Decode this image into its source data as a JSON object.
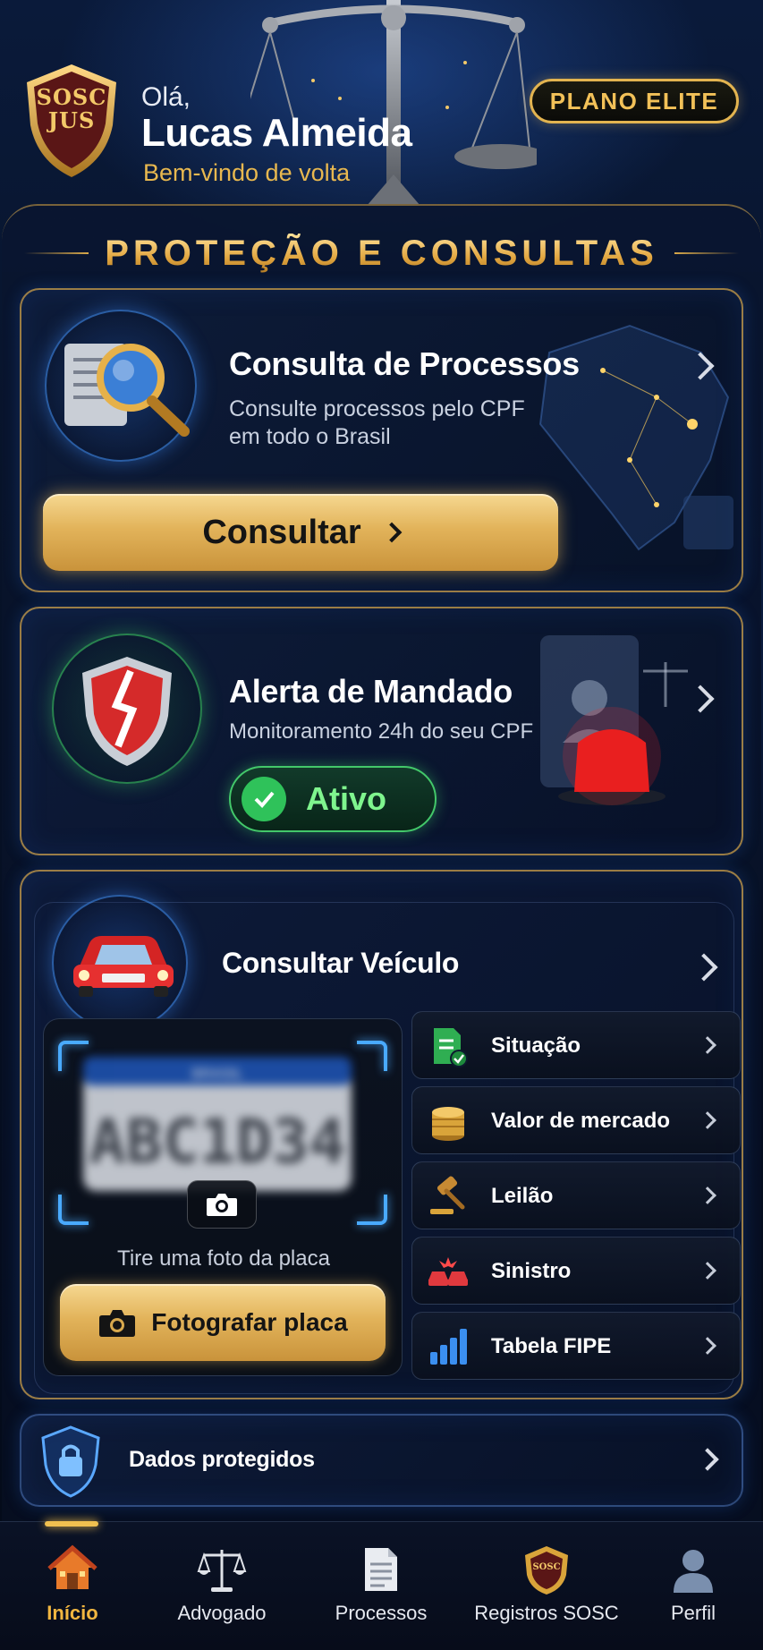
{
  "header": {
    "logo": "SOSC JUS",
    "greeting": "Olá,",
    "user_name": "Lucas Almeida",
    "welcome": "Bem-vindo de volta",
    "plan": "PLANO ELITE"
  },
  "section": {
    "title": "PROTEÇÃO E CONSULTAS"
  },
  "processos": {
    "title": "Consulta de Processos",
    "subtitle_line1": "Consulte processos pelo CPF",
    "subtitle_line2": "em todo o Brasil",
    "button": "Consultar"
  },
  "mandado": {
    "title": "Alerta de Mandado",
    "subtitle": "Monitoramento 24h do seu CPF",
    "status": "Ativo"
  },
  "veiculo": {
    "title": "Consultar Veículo",
    "plate_text": "ABC1D34",
    "plate_country": "BRASIL",
    "photo_hint": "Tire uma foto da placa",
    "photo_button": "Fotografar placa",
    "options": [
      {
        "label": "Situação",
        "icon": "document-check-icon"
      },
      {
        "label": "Valor de mercado",
        "icon": "coins-icon"
      },
      {
        "label": "Leilão",
        "icon": "gavel-icon"
      },
      {
        "label": "Sinistro",
        "icon": "car-crash-icon"
      },
      {
        "label": "Tabela FIPE",
        "icon": "bar-chart-icon"
      }
    ]
  },
  "dados": {
    "label": "Dados protegidos"
  },
  "nav": {
    "items": [
      {
        "label": "Início",
        "icon": "home-icon",
        "active": true
      },
      {
        "label": "Advogado",
        "icon": "scales-icon"
      },
      {
        "label": "Processos",
        "icon": "document-icon"
      },
      {
        "label": "Registros SOSC",
        "icon": "sosc-badge-icon"
      },
      {
        "label": "Perfil",
        "icon": "user-icon"
      }
    ]
  },
  "colors": {
    "gold": "#e3b450",
    "green": "#43c86a",
    "blue": "#49aaff",
    "background": "#050d1f"
  }
}
